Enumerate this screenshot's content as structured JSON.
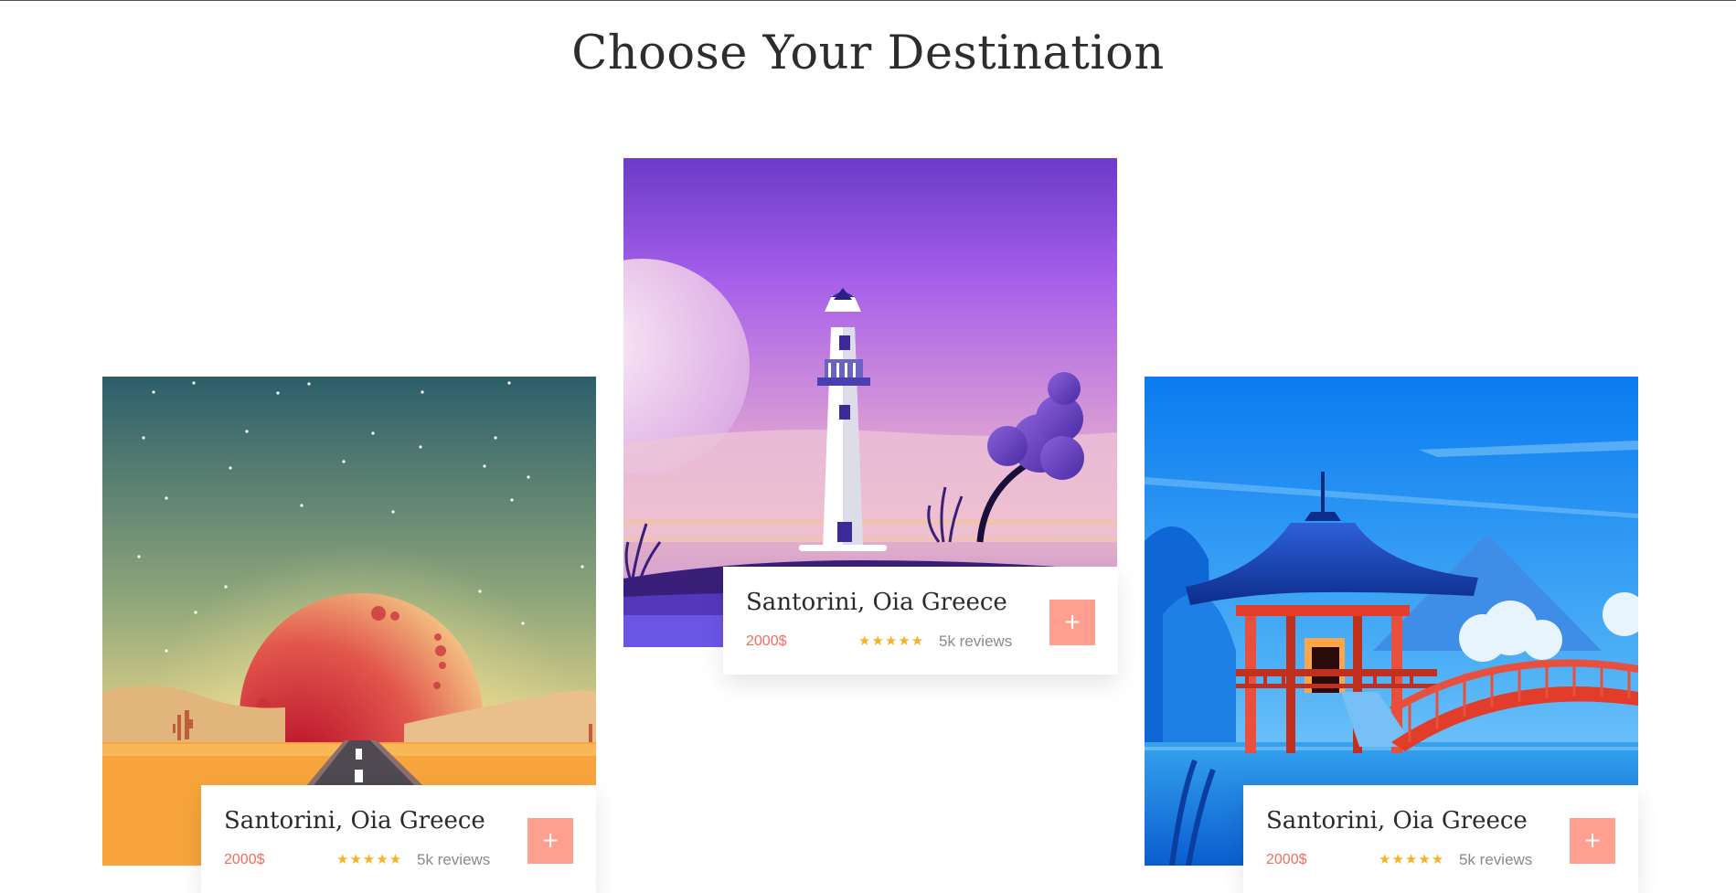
{
  "page": {
    "title": "Choose Your Destination"
  },
  "cards": [
    {
      "title": "Santorini, Oia Greece",
      "price": "2000$",
      "stars": "★★★★★",
      "reviews": "5k reviews",
      "add_label": "+",
      "image": "desert-sunset-road-illustration"
    },
    {
      "title": "Santorini, Oia Greece",
      "price": "2000$",
      "stars": "★★★★★",
      "reviews": "5k reviews",
      "add_label": "+",
      "image": "lighthouse-purple-sky-illustration"
    },
    {
      "title": "Santorini, Oia Greece",
      "price": "2000$",
      "stars": "★★★★★",
      "reviews": "5k reviews",
      "add_label": "+",
      "image": "japanese-pagoda-bridge-illustration"
    }
  ],
  "colors": {
    "accent": "#ff9f8f",
    "price": "#f26d5b",
    "star": "#f5b323"
  }
}
